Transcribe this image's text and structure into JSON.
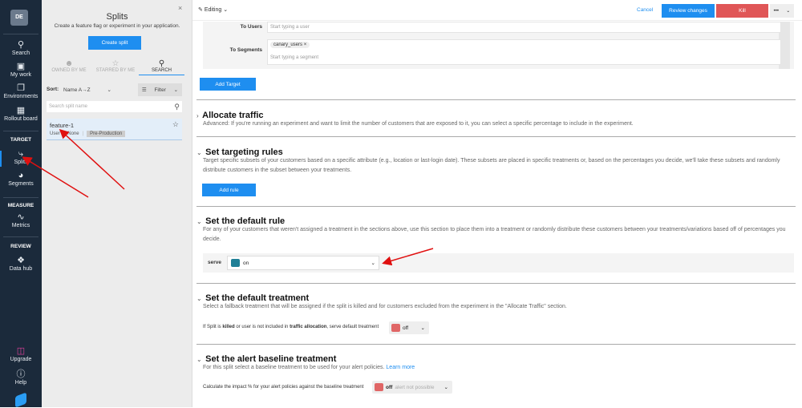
{
  "nav": {
    "avatar": "DE",
    "items": [
      {
        "label": "Search",
        "icon": "search-icon"
      },
      {
        "label": "My work",
        "icon": "badge-icon"
      },
      {
        "label": "Environments",
        "icon": "windows-icon"
      },
      {
        "label": "Rollout board",
        "icon": "grid-icon"
      }
    ],
    "target_heading": "TARGET",
    "splits": "Splits",
    "segments": "Segments",
    "measure_heading": "MEASURE",
    "metrics": "Metrics",
    "review_heading": "REVIEW",
    "data_hub": "Data hub",
    "upgrade": "Upgrade",
    "help": "Help"
  },
  "panel": {
    "title": "Splits",
    "subtitle": "Create a feature flag or experiment in your application.",
    "create": "Create split",
    "close": "×",
    "tabs": [
      {
        "label": "OWNED BY ME"
      },
      {
        "label": "STARRED BY ME"
      },
      {
        "label": "SEARCH",
        "active": true
      }
    ],
    "sort_label": "Sort:",
    "sort_value": "Name A→Z",
    "filter": "Filter",
    "search_placeholder": "Search split name",
    "split": {
      "name": "feature-1",
      "traffic_type": "User",
      "owner": "None",
      "env": "Pre-Production"
    }
  },
  "header": {
    "mode": "Editing",
    "cancel": "Cancel",
    "review": "Review changes",
    "kill": "Kill",
    "more": "•••"
  },
  "targets": {
    "users_label": "To Users",
    "users_placeholder": "Start typing a user",
    "segments_label": "To Segments",
    "segment_tag": "canary_users",
    "segments_placeholder": "Start typing a segment",
    "add_target": "Add Target"
  },
  "allocate": {
    "title": "Allocate traffic",
    "desc": "Advanced: If you're running an experiment and want to limit the number of customers that are exposed to it, you can select a specific percentage to include in the experiment."
  },
  "rules": {
    "title": "Set targeting rules",
    "desc": "Target specific subsets of your customers based on a specific attribute (e.g., location or last-login date). These subsets are placed in specific treatments or, based on the percentages you decide, we'll take these subsets and randomly distribute customers in the subset between your treatments.",
    "add_rule": "Add rule"
  },
  "default_rule": {
    "title": "Set the default rule",
    "desc": "For any of your customers that weren't assigned a treatment in the sections above, use this section to place them into a treatment or randomly distribute these customers between your treatments/variations based off of percentages you decide.",
    "serve": "serve",
    "value": "on",
    "color": "#1f7f96"
  },
  "default_treatment": {
    "title": "Set the default treatment",
    "desc": "Select a fallback treatment that will be assigned if the split is killed and for customers excluded from the experiment in the \"Allocate Traffic\" section.",
    "t1": "If Split is ",
    "t2": "killed",
    "t3": " or user is not included in ",
    "t4": "traffic allocation",
    "t5": ", serve default treatment",
    "value": "off",
    "color": "#e06666"
  },
  "baseline": {
    "title": "Set the alert baseline treatment",
    "desc": "For this split select a baseline treatment to be used for your alert policies.",
    "learn": "Learn more",
    "label": "Calculate the impact % for your alert policies against the baseline treatment",
    "value": "off",
    "note": "alert not possible",
    "color": "#e06666"
  }
}
